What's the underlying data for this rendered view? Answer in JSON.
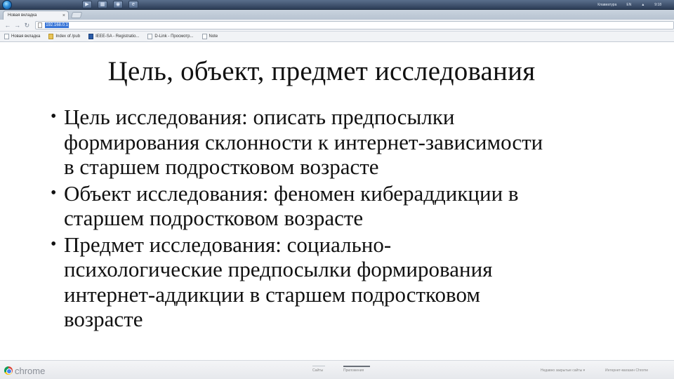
{
  "taskbar": {
    "tray_language": "EN",
    "tray_keyboard": "Клавиатура",
    "tray_clock": "9:18"
  },
  "browser": {
    "tab_title": "Новая вкладка",
    "url": "192.168.0.1",
    "bookmarks": [
      {
        "label": "Новая вкладка"
      },
      {
        "label": "Index of /pub"
      },
      {
        "label": "IEEE-SA - Registratio..."
      },
      {
        "label": "D-Link - Просмотр..."
      },
      {
        "label": "Note"
      }
    ]
  },
  "slide": {
    "title": "Цель, объект, предмет исследования",
    "bullets": [
      {
        "lines": [
          "Цель исследования: описать предпосылки",
          "формирования склонности к интернет-зависимости",
          "в старшем подростковом возрасте"
        ]
      },
      {
        "lines": [
          "Объект исследования: феномен кибераддикции в",
          "старшем подростковом возрасте"
        ]
      },
      {
        "lines": [
          "Предмет исследования: социально-",
          "психологические предпосылки формирования",
          "интернет-аддикции в старшем подростковом",
          "возрасте"
        ]
      }
    ]
  },
  "bottombar": {
    "brand": "chrome",
    "tab_sites": "Сайты",
    "tab_apps": "Приложения",
    "recently_closed": "Недавно закрытые сайты ▾",
    "web_store": "Интернет-магазин Chrome"
  }
}
